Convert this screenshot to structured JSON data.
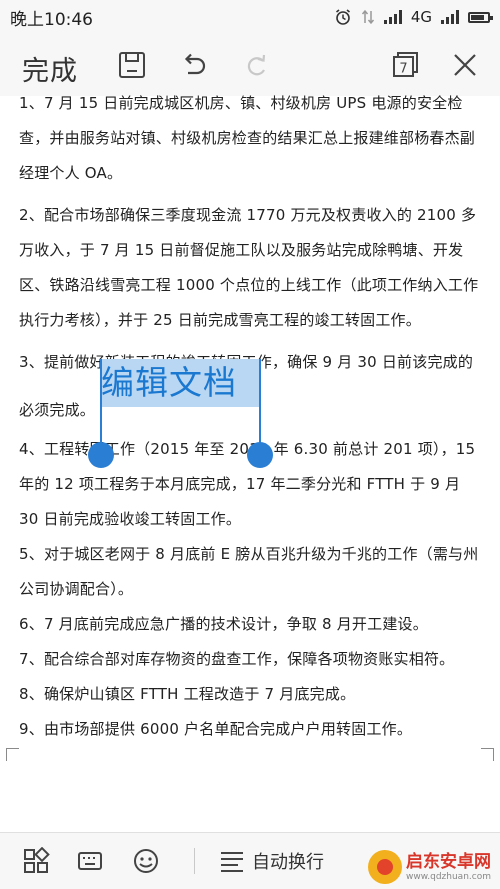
{
  "status_bar": {
    "time": "晚上10:46",
    "network": "4G"
  },
  "toolbar": {
    "done_label": "完成",
    "page_badge": "7",
    "icons": [
      "save-icon",
      "undo-icon",
      "redo-icon",
      "page-view-icon",
      "close-icon"
    ]
  },
  "document": {
    "paragraphs": [
      "1、7 月 15 日前完成城区机房、镇、村级机房 UPS 电源的安全检查，并由服务站对镇、村级机房检查的结果汇总上报建维部杨春杰副经理个人 OA。",
      "2、配合市场部确保三季度现金流 1770 万元及权责收入的 2100 多万收入，于 7 月 15 日前督促施工队以及服务站完成除鸭塘、开发区、铁路沿线雪亮工程 1000 个点位的上线工作（此项工作纳入工作执行力考核），并于 25 日前完成雪亮工程的竣工转固工作。",
      "3、提前做好新装工程的竣工转固工作，确保 9 月 30 日前该完成的必须完成。",
      "4、工程转固工作（2015 年至 2018 年 6.30 前总计 201 项），15 年的 12 项工程务于本月底完成，17 年二季分光和 FTTH 于 9 月 30 日前完成验收竣工转固工作。",
      "5、对于城区老网于 8 月底前 E 膀从百兆升级为千兆的工作（需与州公司协调配合）。",
      "6、7 月底前完成应急广播的技术设计，争取 8 月开工建设。",
      "7、配合综合部对库存物资的盘查工作，保障各项物资账实相符。",
      "8、确保炉山镇区 FTTH 工程改造于 7 月底完成。",
      "9、由市场部提供 6000 户名单配合完成户户用转固工作。"
    ],
    "selection_overlay_text": "编辑文档"
  },
  "bottom_bar": {
    "wrap_label": "自动换行",
    "icons": [
      "grid-icon",
      "keyboard-icon",
      "emoji-icon",
      "wrap-lines-icon"
    ]
  },
  "watermark": {
    "name": "启东安卓网",
    "url": "www.qdzhuan.com"
  },
  "colors": {
    "accent": "#2a7fd4",
    "selection_bg": "#b9d7f3",
    "bar_bg": "#f7f7f7"
  }
}
